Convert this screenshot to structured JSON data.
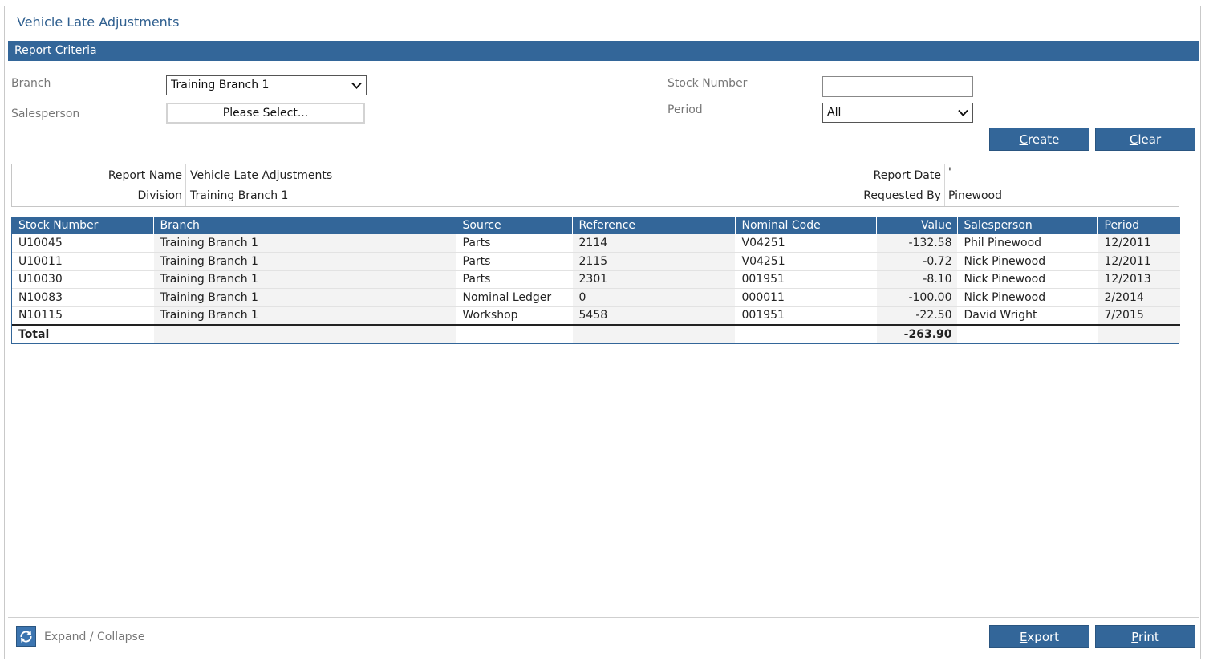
{
  "page": {
    "title": "Vehicle Late Adjustments"
  },
  "criteria": {
    "section_title": "Report Criteria",
    "branch_label": "Branch",
    "branch_value": "Training Branch 1",
    "salesperson_label": "Salesperson",
    "salesperson_button": "Please Select...",
    "stock_number_label": "Stock Number",
    "stock_number_value": "",
    "period_label": "Period",
    "period_value": "All",
    "create_label_underlined": "C",
    "create_label_rest": "reate",
    "clear_label_underlined": "C",
    "clear_label_rest": "lear"
  },
  "report_info": {
    "report_name_label": "Report Name",
    "report_name_value": "Vehicle Late Adjustments",
    "division_label": "Division",
    "division_value": "Training Branch 1",
    "report_date_label": "Report Date",
    "report_date_value": "'",
    "requested_by_label": "Requested By",
    "requested_by_value": "Pinewood"
  },
  "grid": {
    "columns": [
      "Stock Number",
      "Branch",
      "Source",
      "Reference",
      "Nominal Code",
      "Value",
      "Salesperson",
      "Period"
    ],
    "rows": [
      [
        "U10045",
        "Training Branch 1",
        "Parts",
        "2114",
        "V04251",
        "-132.58",
        "Phil Pinewood",
        "12/2011"
      ],
      [
        "U10011",
        "Training Branch 1",
        "Parts",
        "2115",
        "V04251",
        "-0.72",
        "Nick Pinewood",
        "12/2011"
      ],
      [
        "U10030",
        "Training Branch 1",
        "Parts",
        "2301",
        "001951",
        "-8.10",
        "Nick Pinewood",
        "12/2013"
      ],
      [
        "N10083",
        "Training Branch 1",
        "Nominal Ledger",
        "0",
        "000011",
        "-100.00",
        "Nick Pinewood",
        "2/2014"
      ],
      [
        "N10115",
        "Training Branch 1",
        "Workshop",
        "5458",
        "001951",
        "-22.50",
        "David Wright",
        "7/2015"
      ]
    ],
    "total_label": "Total",
    "total_value": "-263.90"
  },
  "footer": {
    "expand_collapse": "Expand / Collapse",
    "export_label_underlined": "E",
    "export_label_rest": "xport",
    "print_label_underlined": "P",
    "print_label_rest": "rint"
  },
  "icons": {
    "expand": "refresh-icon",
    "dropdown": "chevron-down-icon"
  },
  "colors": {
    "accent": "#336699",
    "title": "#2f5f8f"
  }
}
